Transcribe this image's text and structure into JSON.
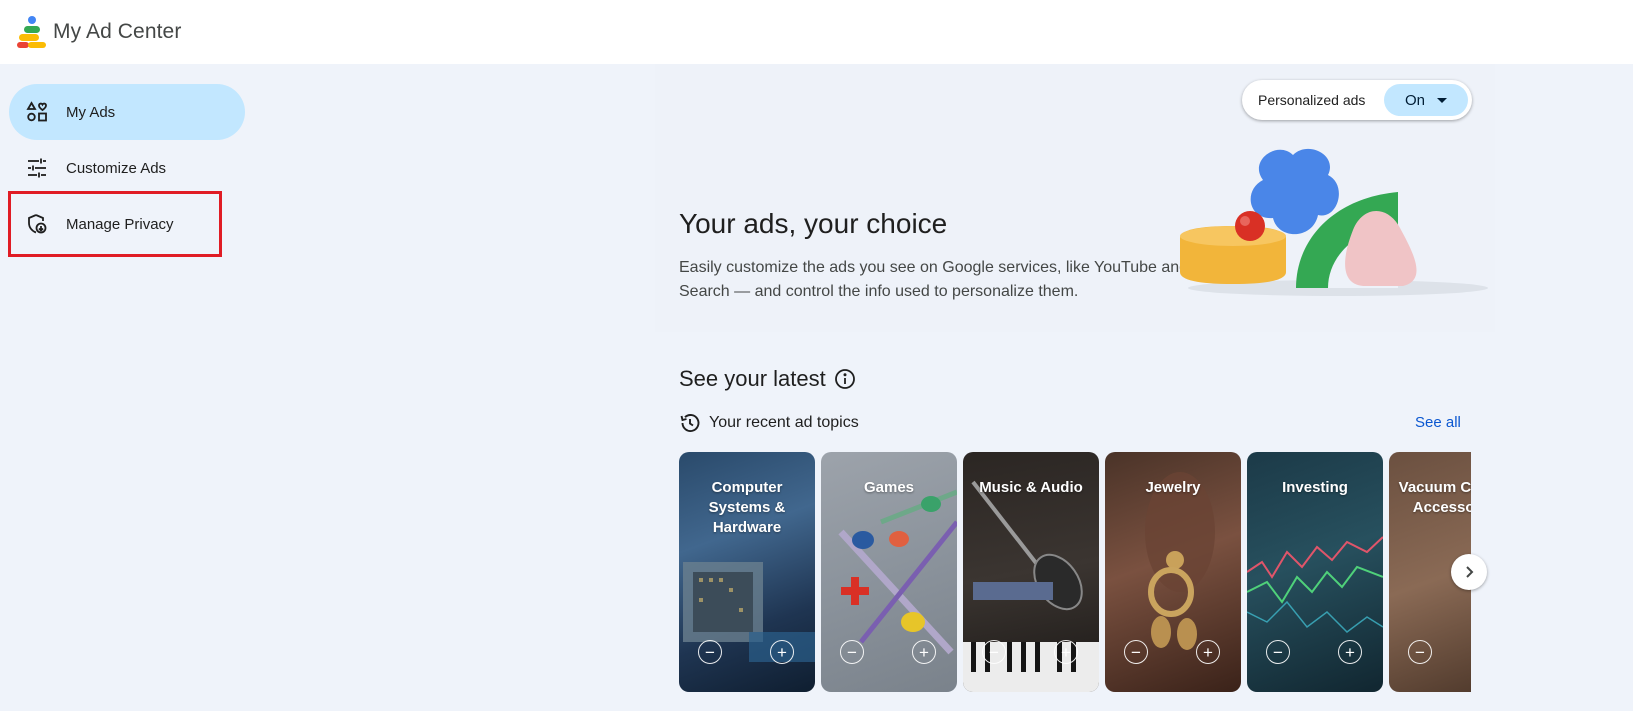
{
  "header": {
    "title": "My Ad Center"
  },
  "sidebar": {
    "items": [
      {
        "label": "My Ads",
        "icon": "my-ads-icon"
      },
      {
        "label": "Customize Ads",
        "icon": "tune-icon"
      },
      {
        "label": "Manage Privacy",
        "icon": "privacy-shield-icon"
      }
    ]
  },
  "toggle": {
    "label": "Personalized ads",
    "value": "On"
  },
  "hero": {
    "title": "Your ads, your choice",
    "description": "Easily customize the ads you see on Google services, like YouTube and Search — and control the info used to personalize them."
  },
  "latest": {
    "title": "See your latest",
    "subtitle": "Your recent ad topics",
    "see_all": "See all",
    "cards": [
      {
        "title": "Computer Systems & Hardware"
      },
      {
        "title": "Games"
      },
      {
        "title": "Music & Audio"
      },
      {
        "title": "Jewelry"
      },
      {
        "title": "Investing"
      },
      {
        "title": "Vacuum Cleaner Accessories"
      }
    ]
  },
  "colors": {
    "accent": "#c2e7ff",
    "link": "#0b57d0",
    "background": "#eff3fa",
    "highlight_box": "#e01b24"
  }
}
